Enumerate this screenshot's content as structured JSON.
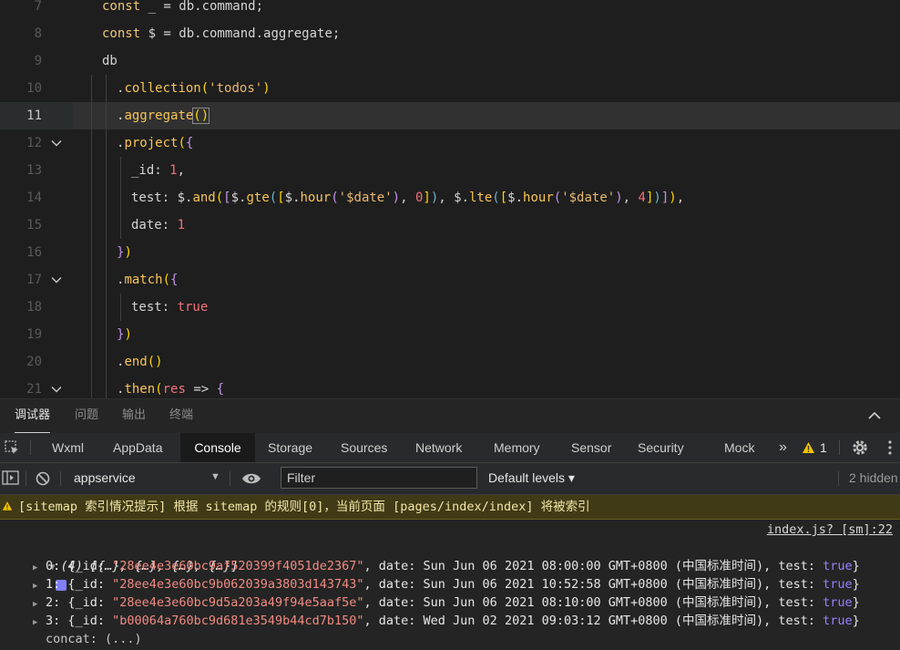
{
  "editor": {
    "lines": [
      {
        "n": "7",
        "fold": false,
        "current": false,
        "indent": 1,
        "tokens": [
          [
            "kw",
            "const "
          ],
          [
            "ident",
            "_ = db.command;"
          ]
        ]
      },
      {
        "n": "8",
        "fold": false,
        "current": false,
        "indent": 1,
        "tokens": [
          [
            "kw",
            "const "
          ],
          [
            "ident",
            "$ = db.command.aggregate;"
          ]
        ]
      },
      {
        "n": "9",
        "fold": false,
        "current": false,
        "indent": 1,
        "tokens": [
          [
            "ident",
            "db"
          ]
        ]
      },
      {
        "n": "10",
        "fold": false,
        "current": false,
        "indent": 2,
        "tokens": [
          [
            "ident",
            "."
          ],
          [
            "fn",
            "collection"
          ],
          [
            "py",
            "("
          ],
          [
            "str",
            "'todos'"
          ],
          [
            "py",
            ")"
          ]
        ]
      },
      {
        "n": "11",
        "fold": false,
        "current": true,
        "indent": 2,
        "tokens": [
          [
            "ident",
            "."
          ],
          [
            "fn",
            "aggregate"
          ],
          [
            "py box",
            "()"
          ]
        ]
      },
      {
        "n": "12",
        "fold": true,
        "current": false,
        "indent": 2,
        "tokens": [
          [
            "ident",
            "."
          ],
          [
            "fn",
            "project"
          ],
          [
            "py",
            "("
          ],
          [
            "pl",
            "{"
          ]
        ]
      },
      {
        "n": "13",
        "fold": false,
        "current": false,
        "indent": 3,
        "tokens": [
          [
            "ident",
            "_id: "
          ],
          [
            "num",
            "1"
          ],
          [
            "ident",
            ","
          ]
        ]
      },
      {
        "n": "14",
        "fold": false,
        "current": false,
        "indent": 3,
        "tokens": [
          [
            "ident",
            "test: $."
          ],
          [
            "fn",
            "and"
          ],
          [
            "py",
            "("
          ],
          [
            "pl",
            "["
          ],
          [
            "ident",
            "$."
          ],
          [
            "fn",
            "gte"
          ],
          [
            "pb",
            "("
          ],
          [
            "py",
            "["
          ],
          [
            "ident",
            "$."
          ],
          [
            "fn",
            "hour"
          ],
          [
            "pl",
            "("
          ],
          [
            "str",
            "'$date'"
          ],
          [
            "pl",
            ")"
          ],
          [
            "ident",
            ", "
          ],
          [
            "num",
            "0"
          ],
          [
            "py",
            "]"
          ],
          [
            "pb",
            ")"
          ],
          [
            "ident",
            ", $."
          ],
          [
            "fn",
            "lte"
          ],
          [
            "pb",
            "("
          ],
          [
            "py",
            "["
          ],
          [
            "ident",
            "$."
          ],
          [
            "fn",
            "hour"
          ],
          [
            "pl",
            "("
          ],
          [
            "str",
            "'$date'"
          ],
          [
            "pl",
            ")"
          ],
          [
            "ident",
            ", "
          ],
          [
            "num",
            "4"
          ],
          [
            "py",
            "]"
          ],
          [
            "pb",
            ")"
          ],
          [
            "pl",
            "]"
          ],
          [
            "py",
            ")"
          ],
          [
            "ident",
            ","
          ]
        ]
      },
      {
        "n": "15",
        "fold": false,
        "current": false,
        "indent": 3,
        "tokens": [
          [
            "ident",
            "date: "
          ],
          [
            "num",
            "1"
          ]
        ]
      },
      {
        "n": "16",
        "fold": false,
        "current": false,
        "indent": 2,
        "tokens": [
          [
            "pl",
            "}"
          ],
          [
            "py",
            ")"
          ]
        ]
      },
      {
        "n": "17",
        "fold": true,
        "current": false,
        "indent": 2,
        "tokens": [
          [
            "ident",
            "."
          ],
          [
            "fn",
            "match"
          ],
          [
            "py",
            "("
          ],
          [
            "pl",
            "{"
          ]
        ]
      },
      {
        "n": "18",
        "fold": false,
        "current": false,
        "indent": 3,
        "tokens": [
          [
            "ident",
            "test: "
          ],
          [
            "bool",
            "true"
          ]
        ]
      },
      {
        "n": "19",
        "fold": false,
        "current": false,
        "indent": 2,
        "tokens": [
          [
            "pl",
            "}"
          ],
          [
            "py",
            ")"
          ]
        ]
      },
      {
        "n": "20",
        "fold": false,
        "current": false,
        "indent": 2,
        "tokens": [
          [
            "ident",
            "."
          ],
          [
            "fn",
            "end"
          ],
          [
            "py",
            "()"
          ]
        ]
      },
      {
        "n": "21",
        "fold": true,
        "current": false,
        "indent": 2,
        "tokens": [
          [
            "ident",
            "."
          ],
          [
            "fn",
            "then"
          ],
          [
            "py",
            "("
          ],
          [
            "num",
            "res"
          ],
          [
            "ident",
            " => "
          ],
          [
            "pl",
            "{"
          ]
        ]
      }
    ]
  },
  "panel": {
    "tabs": [
      "调试器",
      "问题",
      "输出",
      "终端"
    ],
    "active": 0
  },
  "devtools": {
    "tabs": [
      "Wxml",
      "AppData",
      "Console",
      "Storage",
      "Sources",
      "Network",
      "Memory",
      "Sensor",
      "Security",
      "Mock"
    ],
    "active_tab": "Console",
    "more": "»",
    "warn_count": "1"
  },
  "console_bar": {
    "context": "appservice",
    "filter_placeholder": "Filter",
    "levels": "Default levels ▾",
    "hidden": "2 hidden"
  },
  "console": {
    "warning": "[sitemap 索引情况提示] 根据 sitemap 的规则[0]，当前页面 [pages/index/index] 将被索引",
    "source": "index.js? [sm]:22",
    "array_summary": "(4) [{…}, {…}, {…}, {…}]",
    "items": [
      {
        "idx": "0",
        "id": "\"28ee4e3e60bc9af520399f4051de2367\"",
        "date": "Sun Jun 06 2021 08:00:00 GMT+0800 (中国标准时间)",
        "test": "true"
      },
      {
        "idx": "1",
        "id": "\"28ee4e3e60bc9b062039a3803d143743\"",
        "date": "Sun Jun 06 2021 10:52:58 GMT+0800 (中国标准时间)",
        "test": "true"
      },
      {
        "idx": "2",
        "id": "\"28ee4e3e60bc9d5a203a49f94e5aaf5e\"",
        "date": "Sun Jun 06 2021 08:10:00 GMT+0800 (中国标准时间)",
        "test": "true"
      },
      {
        "idx": "3",
        "id": "\"b00064a760bc9d681e3549b44cd7b150\"",
        "date": "Wed Jun 02 2021 09:03:12 GMT+0800 (中国标准时间)",
        "test": "true"
      }
    ],
    "concat": "concat: (...)"
  },
  "colors": {
    "accent": "#ffd700",
    "warning_bg": "#413a16",
    "true_color": "#9980ff",
    "string_color": "#f28b82"
  }
}
